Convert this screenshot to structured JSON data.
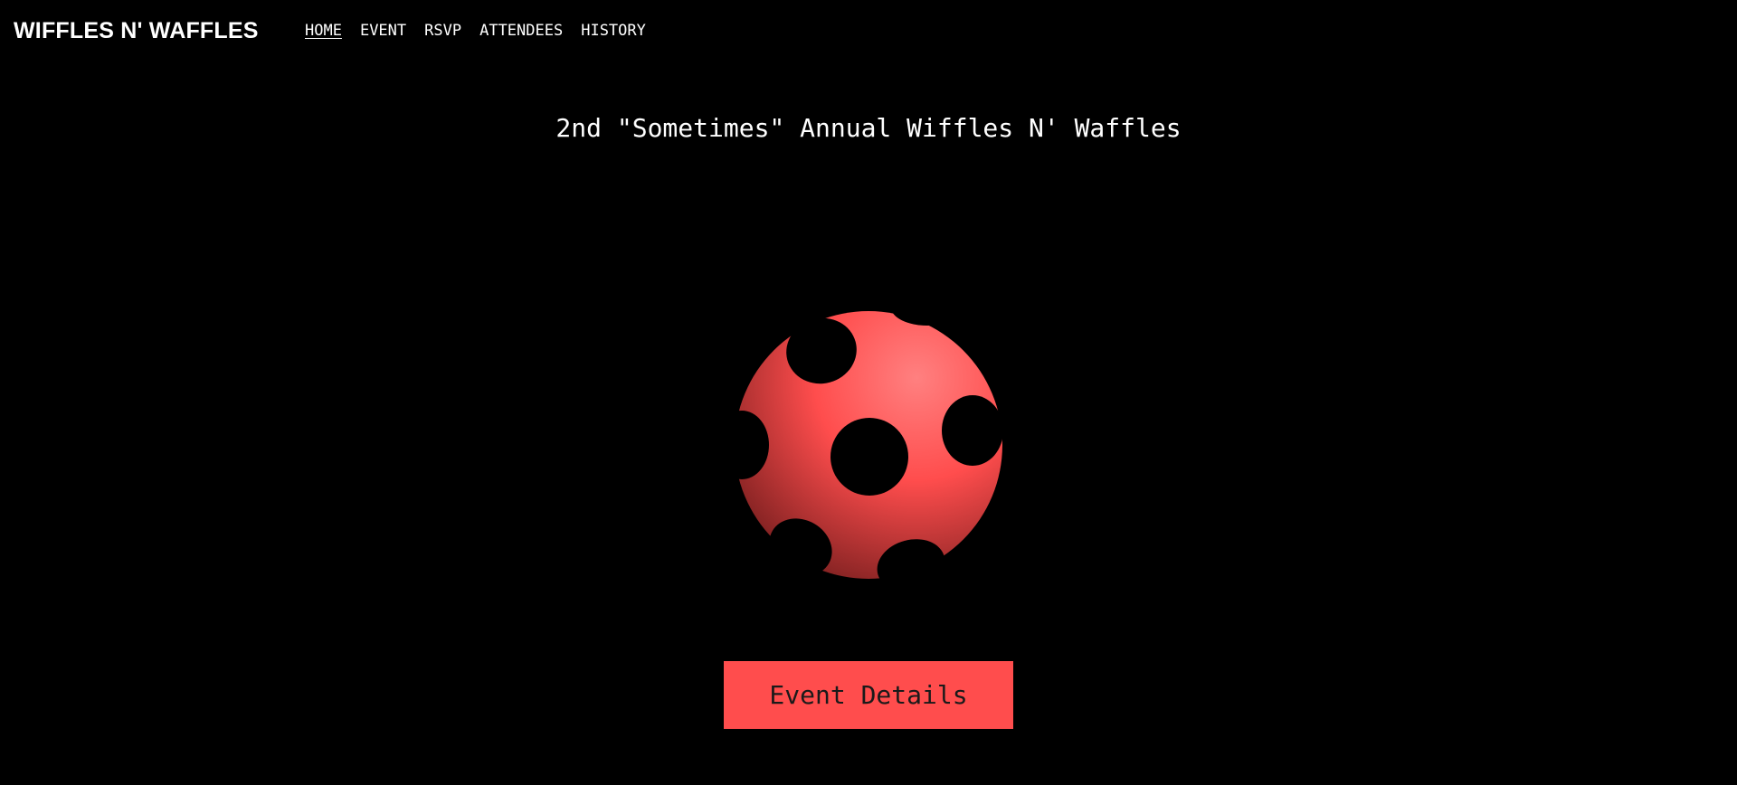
{
  "header": {
    "brand": "WIFFLES N' WAFFLES",
    "nav": [
      {
        "label": "HOME",
        "active": true
      },
      {
        "label": "EVENT",
        "active": false
      },
      {
        "label": "RSVP",
        "active": false
      },
      {
        "label": "ATTENDEES",
        "active": false
      },
      {
        "label": "HISTORY",
        "active": false
      }
    ]
  },
  "hero": {
    "title": "2nd \"Sometimes\" Annual Wiffles N' Waffles",
    "image": "wiffle-ball-icon",
    "cta_label": "Event Details"
  },
  "colors": {
    "background": "#000000",
    "text": "#ffffff",
    "accent": "#ff4d4d",
    "ball_highlight": "#ff8080",
    "ball_shadow": "#7a1f1f",
    "button_text": "#1a1a1a"
  }
}
